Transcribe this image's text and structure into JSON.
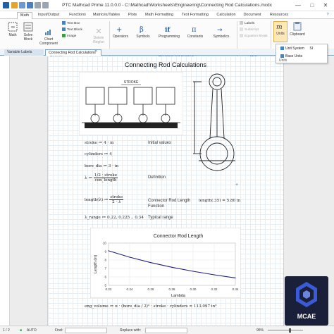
{
  "window": {
    "title": "PTC Mathcad Prime 11.0.0.0 - C:\\Mathcad\\Worksheets\\Engineering\\Connecting Rod Calculations.mcdx",
    "controls": [
      "—",
      "□",
      "✕"
    ],
    "help": "?"
  },
  "menu_tabs": [
    "Math",
    "Input/Output",
    "Functions",
    "Matrices/Tables",
    "Plots",
    "Math Formatting",
    "Text Formatting",
    "Calculation",
    "Document",
    "Resources"
  ],
  "ribbon": {
    "math": "Math",
    "solve_block": "Solve Block",
    "chart_component": "Chart Component",
    "text_box": "Text Box",
    "text_block": "Text Block",
    "image": "Image",
    "delete_region": "Delete Region",
    "regions_label": "Regions",
    "operators": "Operators",
    "symbols": "Symbols",
    "programming": "Programming",
    "constants": "Constants",
    "symbolics": "Symbolics",
    "operators_symbols_label": "Operators and Symbols",
    "labels": "Labels",
    "subscript": "Subscript",
    "equation_break": "Equation Break",
    "style_label": "Style",
    "units": "Units",
    "clipboard": "Clipboard"
  },
  "units_dropdown": {
    "items": [
      "Unit System",
      "Base Units"
    ],
    "item_suffix": "SI",
    "units_label": "Units"
  },
  "doc_tabs": [
    "Variable Labels",
    "Connecting Rod Calculations"
  ],
  "document": {
    "title": "Connecting Rod Calculations",
    "engine_header": "STROKE",
    "eq_stroke": "stroke ≔ 4 · in",
    "eq_cylinders": "cylinders ≔ 4",
    "eq_bore": "bore_dia ≔ 3 · in",
    "lambda_lhs": "λ ≔",
    "lambda_num": "1/2 · stroke",
    "lambda_den": "con_length",
    "length_lhs": "length(λ) ≔",
    "length_num": "stroke",
    "length_den": "2 · λ",
    "eq_range": "λ_range ≔ 0.22, 0.225 .. 0.34",
    "eval_length": "length(.35) = 5.80 in",
    "eng_volume": "eng_volume ≔ π · (bore_dia / 2)² · stroke · cylinders = 113.097 in³",
    "notes": {
      "initial": "Initial values",
      "definition": "Definition",
      "connector": "Connector Rod Length Function",
      "typical": "Typical range"
    }
  },
  "chart_data": {
    "type": "line",
    "title": "Connector Rod Length",
    "xlabel": "Lambda",
    "ylabel": "Length (in)",
    "x": [
      0.22,
      0.24,
      0.26,
      0.28,
      0.3,
      0.32,
      0.34
    ],
    "series": [
      {
        "values": [
          9.09,
          8.33,
          7.69,
          7.14,
          6.67,
          6.25,
          5.88
        ]
      }
    ],
    "xlim": [
      0.22,
      0.34
    ],
    "ylim": [
      5,
      10
    ],
    "xticks": [
      "0.22",
      "0.24",
      "0.26",
      "0.28",
      "0.30",
      "0.32",
      "0.34"
    ],
    "yticks": [
      "5",
      "6",
      "7",
      "8",
      "9",
      "10"
    ],
    "line_color": "#1f1f7a"
  },
  "statusbar": {
    "page": "1 / 2",
    "mode": "AUTO",
    "find_label": "Find:",
    "replace_label": "Replace with:",
    "zoom": "95%"
  },
  "logo": {
    "text": "MCAE"
  },
  "colors": {
    "accent": "#2b6cb0",
    "tab_blue": "#7fa2c4",
    "logo_bg": "#1a1f3a",
    "logo_hex": "#3b5bd6"
  }
}
